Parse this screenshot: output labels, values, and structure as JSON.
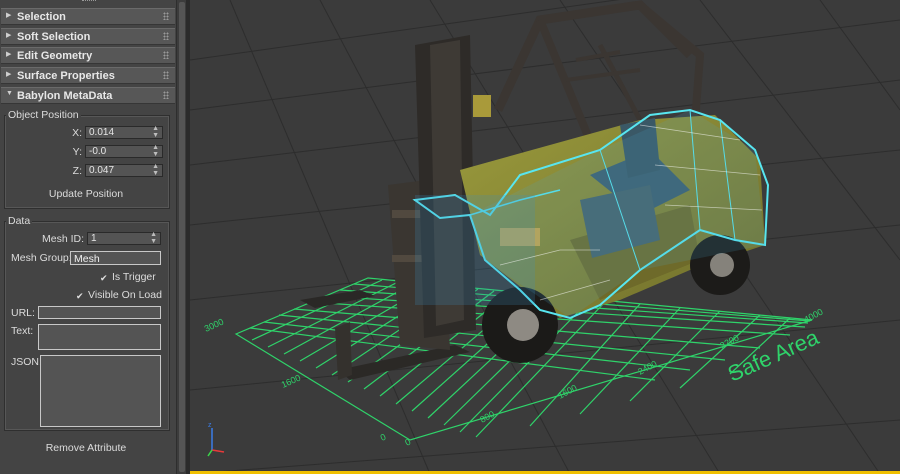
{
  "rollouts": [
    {
      "label": "Selection",
      "expanded": false
    },
    {
      "label": "Soft Selection",
      "expanded": false
    },
    {
      "label": "Edit Geometry",
      "expanded": false
    },
    {
      "label": "Surface Properties",
      "expanded": false
    },
    {
      "label": "Babylon MetaData",
      "expanded": true
    }
  ],
  "object_position": {
    "title": "Object Position",
    "x_label": "X:",
    "x_value": "0.014",
    "y_label": "Y:",
    "y_value": "-0.0",
    "z_label": "Z:",
    "z_value": "0.047",
    "update_button": "Update Position"
  },
  "data_group": {
    "title": "Data",
    "mesh_id_label": "Mesh ID:",
    "mesh_id_value": "1",
    "mesh_group_label": "Mesh Group:",
    "mesh_group_value": "Mesh",
    "is_trigger_label": "Is Trigger",
    "is_trigger_checked": true,
    "visible_on_load_label": "Visible On Load",
    "visible_on_load_checked": true,
    "url_label": "URL:",
    "url_value": "",
    "text_label": "Text:",
    "text_value": "",
    "json_label": "JSON:",
    "json_value": "",
    "remove_button": "Remove Attribute"
  },
  "viewport": {
    "safe_area_label": "Safe Area",
    "grid_color": "#2fd36a",
    "selection_color": "#58e6f0",
    "axis_labels_left": [
      "3000",
      "1600",
      "0"
    ],
    "axis_labels_bottom": [
      "0",
      "800",
      "1600",
      "2400",
      "3200",
      "4000"
    ]
  },
  "colors": {
    "panel_bg": "#444444",
    "rollout_bg": "#575757",
    "viewport_bg": "#3b3b3b",
    "active_viewport_border": "#f0c000"
  },
  "icons": {
    "rollout_collapsed": "triangle-right-icon",
    "rollout_expanded": "triangle-down-icon",
    "spinner": "spinner-arrows-icon",
    "checkbox": "checkmark-icon",
    "axis_gizmo": "xyz-axis-icon"
  }
}
